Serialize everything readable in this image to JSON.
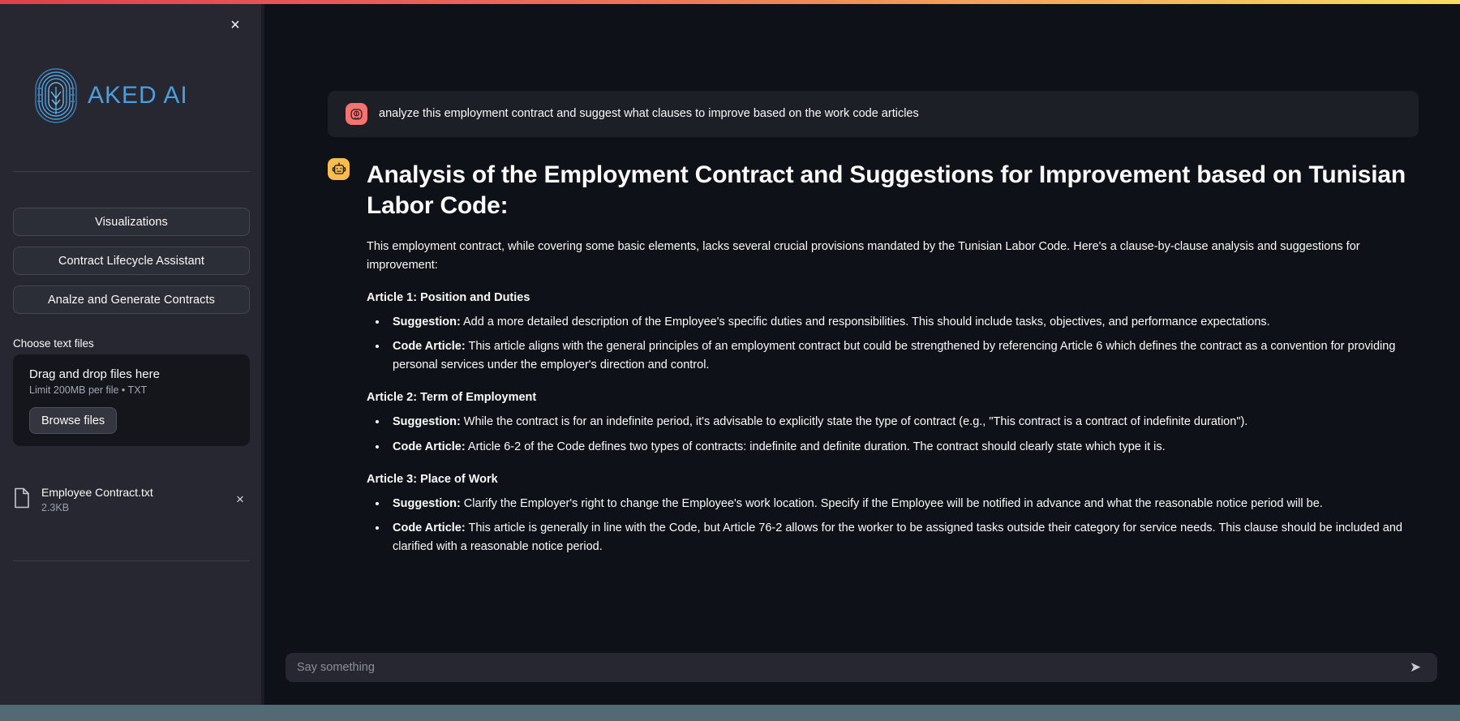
{
  "theme": {
    "top_gradient_from": "#e0404a",
    "top_gradient_to": "#f7e05f",
    "sidebar_bg": "#262730",
    "main_bg": "#0e1117",
    "text": "#fafafa",
    "brand_blue": "#4a9fe0",
    "user_avatar_bg": "#f4726f",
    "assistant_avatar_bg": "#fbbc4f",
    "bottom_strip": "#536a74"
  },
  "sidebar": {
    "close_label": "×",
    "logo_text": "AKED AI",
    "buttons": [
      {
        "label": "Visualizations"
      },
      {
        "label": "Contract Lifecycle Assistant"
      },
      {
        "label": "Analze and Generate Contracts"
      }
    ],
    "uploader": {
      "label": "Choose text files",
      "dropzone_title": "Drag and drop files here",
      "dropzone_sub": "Limit 200MB per file • TXT",
      "browse_label": "Browse files"
    },
    "files": [
      {
        "name": "Employee Contract.txt",
        "size": "2.3KB",
        "remove_label": "×"
      }
    ]
  },
  "conversation": {
    "user_message": "analyze this employment contract and suggest what clauses to improve based on the work code articles",
    "assistant": {
      "title": "Analysis of the Employment Contract and Suggestions for Improvement based on Tunisian Labor Code:",
      "intro": "This employment contract, while covering some basic elements, lacks several crucial provisions mandated by the Tunisian Labor Code. Here's a clause-by-clause analysis and suggestions for improvement:",
      "sections": [
        {
          "heading": "Article 1: Position and Duties",
          "items": [
            {
              "label": "Suggestion:",
              "text": " Add a more detailed description of the Employee's specific duties and responsibilities. This should include tasks, objectives, and performance expectations."
            },
            {
              "label": "Code Article:",
              "text": " This article aligns with the general principles of an employment contract but could be strengthened by referencing Article 6 which defines the contract as a convention for providing personal services under the employer's direction and control."
            }
          ]
        },
        {
          "heading": "Article 2: Term of Employment",
          "items": [
            {
              "label": "Suggestion:",
              "text": " While the contract is for an indefinite period, it's advisable to explicitly state the type of contract (e.g., \"This contract is a contract of indefinite duration\")."
            },
            {
              "label": "Code Article:",
              "text": " Article 6-2 of the Code defines two types of contracts: indefinite and definite duration. The contract should clearly state which type it is."
            }
          ]
        },
        {
          "heading": "Article 3: Place of Work",
          "items": [
            {
              "label": "Suggestion:",
              "text": " Clarify the Employer's right to change the Employee's work location. Specify if the Employee will be notified in advance and what the reasonable notice period will be."
            },
            {
              "label": "Code Article:",
              "text": " This article is generally in line with the Code, but Article 76-2 allows for the worker to be assigned tasks outside their category for service needs. This clause should be included and clarified with a reasonable notice period."
            }
          ]
        }
      ]
    }
  },
  "chat_input": {
    "value": "",
    "placeholder": "Say something",
    "send_label": "➤"
  }
}
